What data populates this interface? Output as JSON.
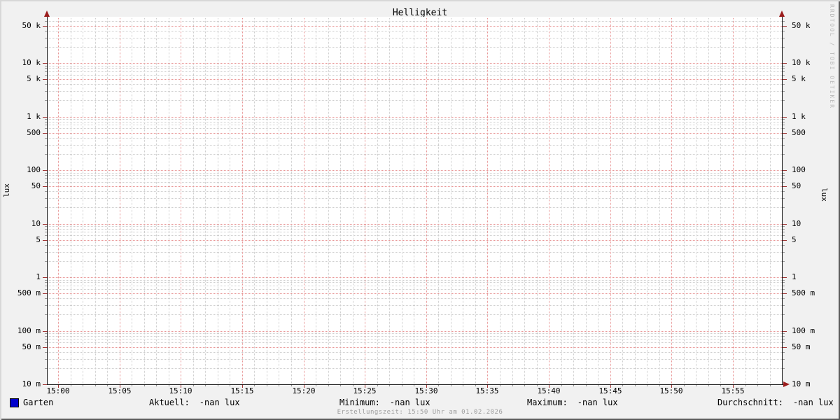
{
  "title": "Helligkeit",
  "watermark": "RRDTOOL / TOBI OETIKER",
  "footer": "Erstellungszeit: 15:50 Uhr am 01.02.2026",
  "y_axis": {
    "unit": "lux"
  },
  "legend": {
    "series_label": "Garten",
    "series_color": "#0000cc",
    "stats": [
      {
        "label": "Aktuell:",
        "value": "-nan lux"
      },
      {
        "label": "Minimum:",
        "value": "-nan lux"
      },
      {
        "label": "Maximum:",
        "value": "-nan lux"
      },
      {
        "label": "Durchschnitt:",
        "value": "-nan lux"
      }
    ]
  },
  "colors": {
    "background": "#f1f1f1",
    "canvas": "#ffffff",
    "major_grid": "#e89494",
    "minor_grid": "#cdcdcd",
    "axis": "#1a1a1a",
    "arrow": "#9b1c1c",
    "series": "#0000cc",
    "watermark_text": "#b9b9b9"
  },
  "chart_data": {
    "type": "line",
    "title": "Helligkeit",
    "ylabel": "lux",
    "y_scale": "logarithmic",
    "ylim": [
      0.01,
      70000
    ],
    "y_tick_values": [
      0.01,
      0.05,
      0.1,
      0.5,
      1,
      5,
      10,
      50,
      100,
      500,
      1000,
      5000,
      10000,
      50000
    ],
    "y_tick_labels": [
      "10 m",
      "50 m",
      "100 m",
      "500 m",
      "1",
      "5",
      "10",
      "50",
      "100",
      "500",
      "1 k",
      "5 k",
      "10 k",
      "50 k"
    ],
    "x_tick_minutes": [
      0,
      5,
      10,
      15,
      20,
      25,
      30,
      35,
      40,
      45,
      50,
      55
    ],
    "x_tick_labels": [
      "15:00",
      "15:05",
      "15:10",
      "15:15",
      "15:20",
      "15:25",
      "15:30",
      "15:35",
      "15:40",
      "15:45",
      "15:50",
      "15:55"
    ],
    "x_minor_step_minutes": 1,
    "x_total_minutes": 59,
    "grid": true,
    "legend_position": "bottom",
    "series": [
      {
        "name": "Garten",
        "color": "#0000cc",
        "values": []
      }
    ],
    "stats": {
      "Aktuell": "-nan lux",
      "Minimum": "-nan lux",
      "Maximum": "-nan lux",
      "Durchschnitt": "-nan lux"
    }
  }
}
